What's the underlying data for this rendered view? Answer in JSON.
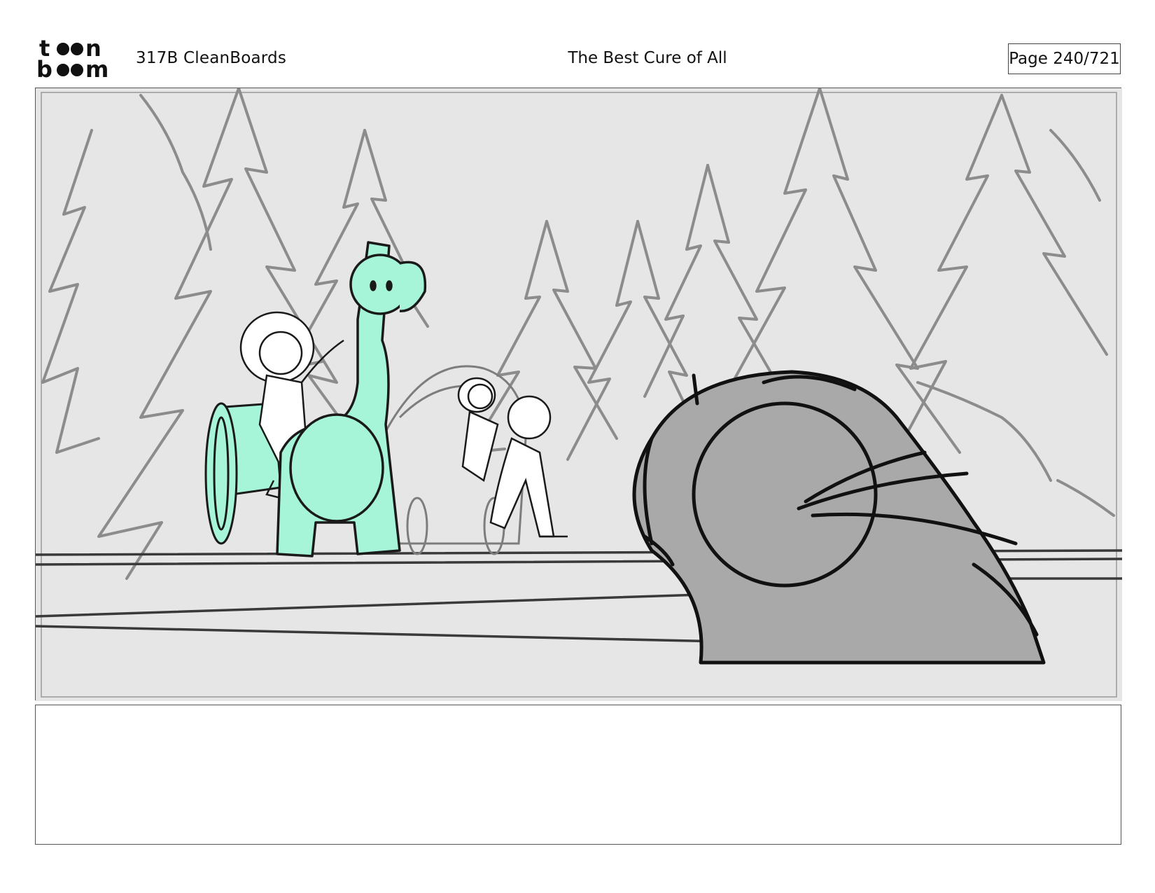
{
  "header": {
    "logo_text": "toonboom",
    "production": "317B  CleanBoards",
    "title": "The Best Cure of All",
    "page_label": "Page 240/721"
  },
  "panel": {
    "colors": {
      "background": "#e6e6e6",
      "tree_lines": "#8a8a8a",
      "ink": "#1a1a1a",
      "dino_fill": "#a6f5d9",
      "foreground_fill": "#a9a9a9"
    }
  },
  "caption": {
    "text": ""
  }
}
